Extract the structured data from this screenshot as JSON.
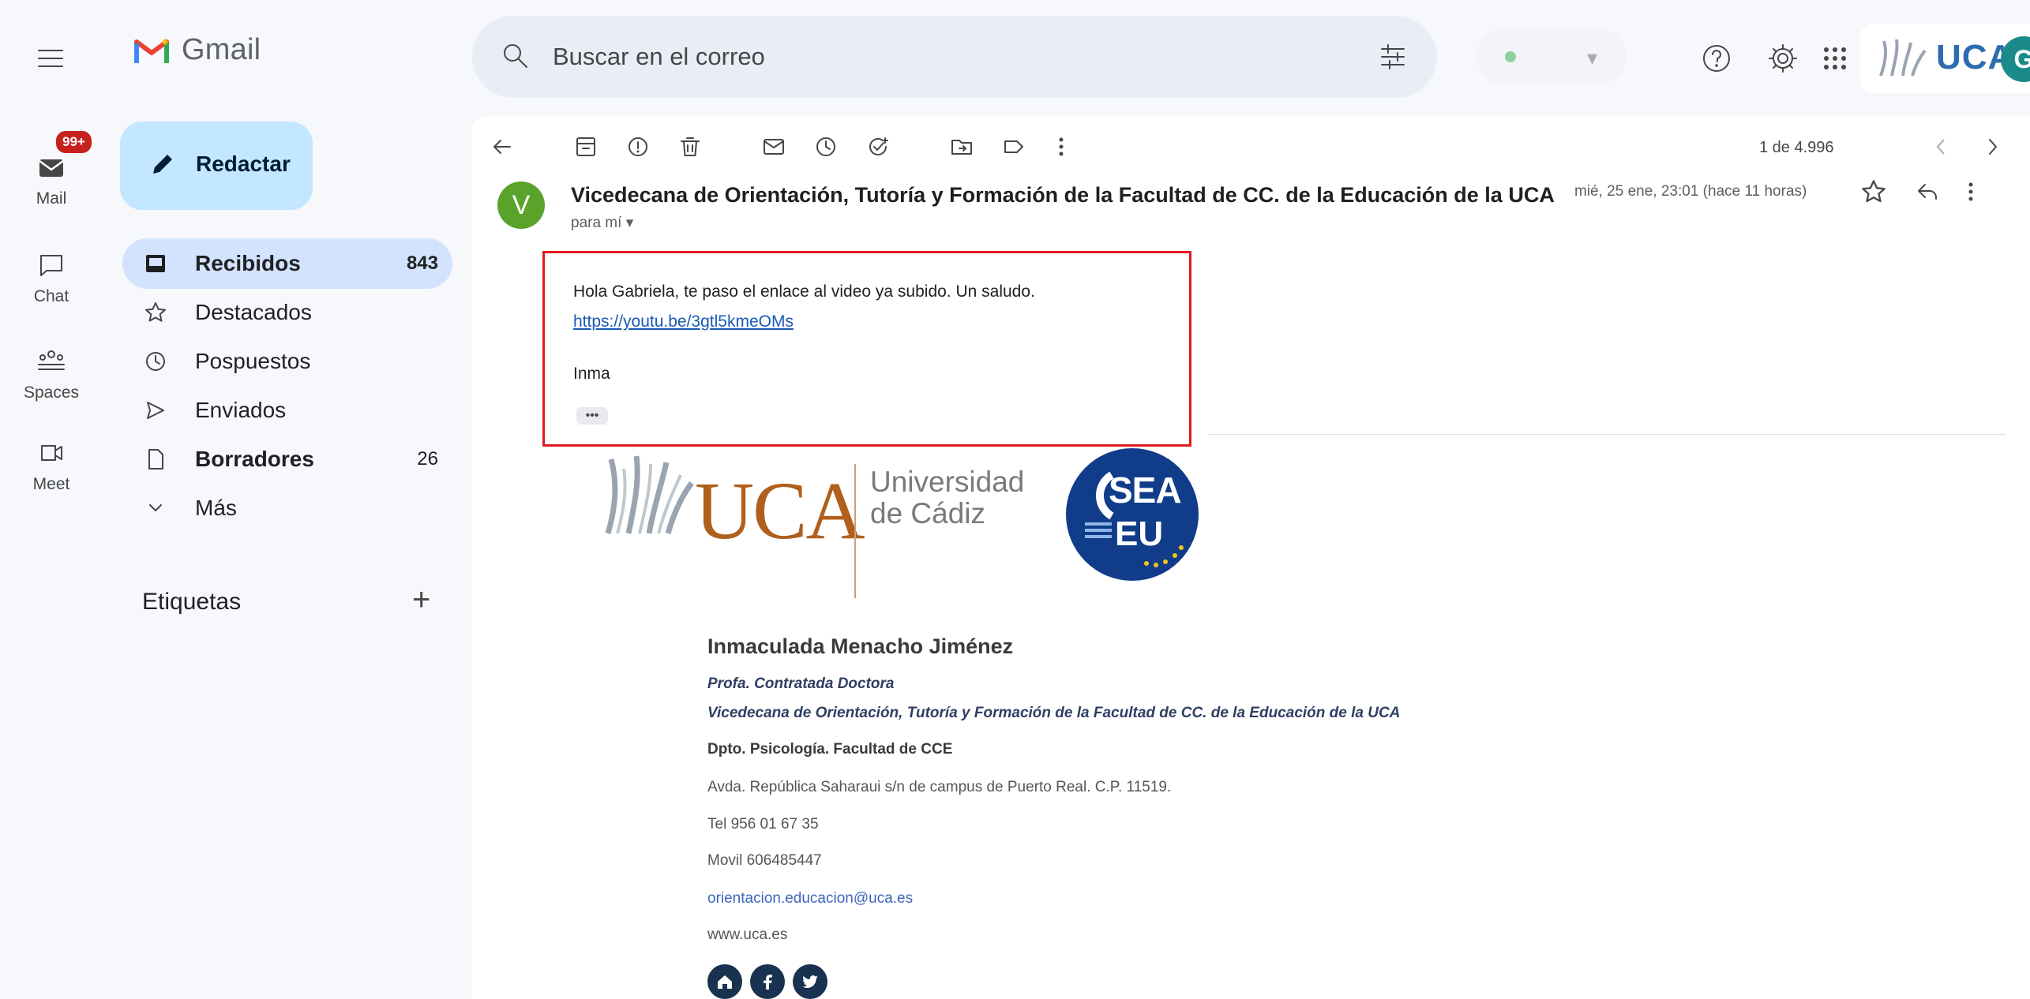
{
  "topbar": {
    "app_name": "Gmail",
    "search_placeholder": "Buscar en el correo",
    "account_chip_label": "UCA",
    "avatar_initial": "G"
  },
  "rail": {
    "mail_badge": "99+",
    "items": [
      {
        "label": "Mail",
        "icon": "mail-icon"
      },
      {
        "label": "Chat",
        "icon": "chat-icon"
      },
      {
        "label": "Spaces",
        "icon": "spaces-icon"
      },
      {
        "label": "Meet",
        "icon": "meet-icon"
      }
    ]
  },
  "compose": {
    "label": "Redactar"
  },
  "nav": {
    "items": [
      {
        "label": "Recibidos",
        "count": "843",
        "icon": "inbox-icon",
        "active": true
      },
      {
        "label": "Destacados",
        "count": "",
        "icon": "star-icon"
      },
      {
        "label": "Pospuestos",
        "count": "",
        "icon": "clock-icon"
      },
      {
        "label": "Enviados",
        "count": "",
        "icon": "send-icon"
      },
      {
        "label": "Borradores",
        "count": "26",
        "icon": "draft-icon"
      },
      {
        "label": "Más",
        "count": "",
        "icon": "chevron-down-icon"
      }
    ],
    "labels_title": "Etiquetas",
    "labels_add": "+"
  },
  "toolbar": {
    "page_count": "1 de 4.996"
  },
  "message": {
    "avatar_initial": "V",
    "sender": "Vicedecana de Orientación, Tutoría y Formación de la Facultad de CC. de la Educación de la UCA",
    "to_line": "para mí ▾",
    "date": "mié, 25 ene, 23:01 (hace 11 horas)",
    "greeting": "Hola Gabriela, te paso el enlace al video ya subido. Un saludo.",
    "link": "https://youtu.be/3gtl5kmeOMs",
    "signoff": "Inma",
    "ellipsis": "•••"
  },
  "signature": {
    "uca_wordmark": "UCA",
    "uca_name_line1": "Universidad",
    "uca_name_line2": "de Cádiz",
    "sea_line1": "SEA",
    "sea_line2": "EU",
    "name": "Inmaculada Menacho Jiménez",
    "role1": "Profa. Contratada Doctora",
    "role2": "Vicedecana de Orientación, Tutoría y Formación de la Facultad de CC. de la Educación de la UCA",
    "dept": "Dpto. Psicología. Facultad de CCE",
    "address": "Avda. República Saharaui s/n de campus de Puerto Real. C.P. 11519.",
    "tel": "Tel 956 01 67 35",
    "mobile": "Movil 606485447",
    "email": "orientacion.educacion@uca.es",
    "web": "www.uca.es",
    "social": [
      "home-icon",
      "facebook-icon",
      "twitter-icon"
    ]
  },
  "colors": {
    "compose_bg": "#c2e7ff",
    "active_nav_bg": "#d3e3fd",
    "highlight_border": "#e0191f",
    "link": "#1a5ab5"
  }
}
